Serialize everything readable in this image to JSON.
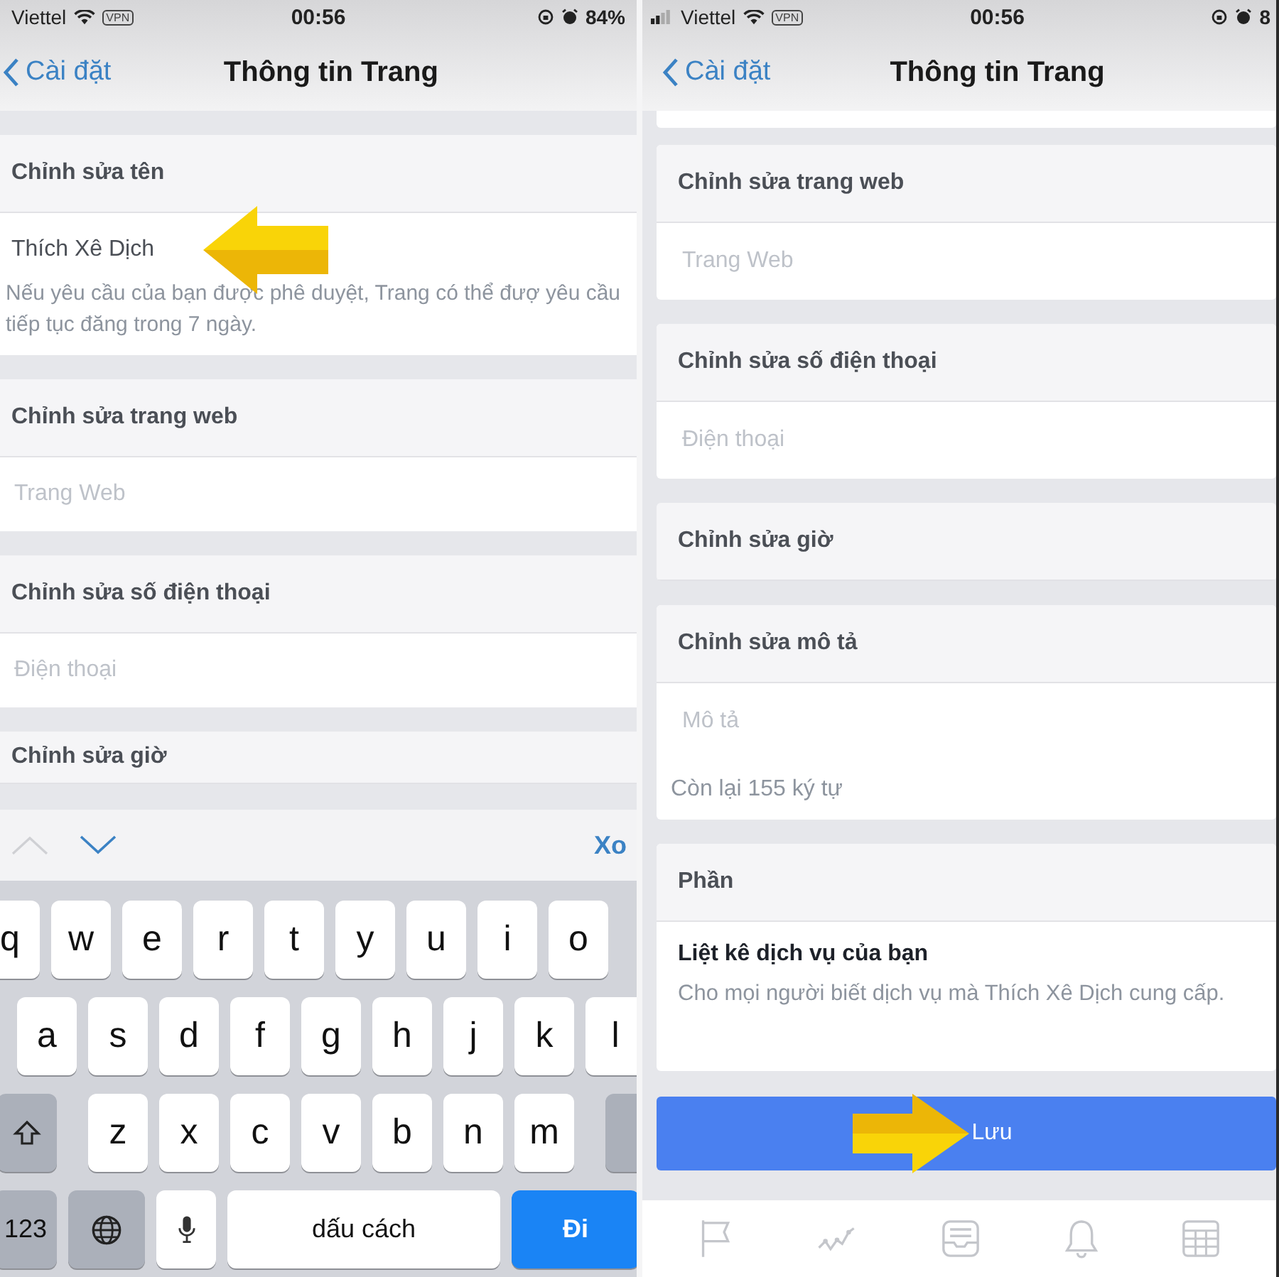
{
  "left_screen": {
    "status_bar": {
      "carrier": "Viettel",
      "vpn": "VPN",
      "time": "00:56",
      "battery": "84%"
    },
    "nav": {
      "back": "Cài đặt",
      "title": "Thông tin Trang"
    },
    "sections": [
      {
        "kind": "field",
        "header": "Chỉnh sửa tên",
        "value": "Thích Xê Dịch",
        "note": "Nếu yêu cầu của bạn được phê duyệt, Trang có thể đượ yêu cầu tiếp tục đăng trong 7 ngày.",
        "arrow": true
      },
      {
        "kind": "field",
        "header": "Chỉnh sửa trang web",
        "placeholder": "Trang Web",
        "arrow": false
      },
      {
        "kind": "field",
        "header": "Chỉnh sửa số điện thoại",
        "placeholder": "Điện thoại",
        "arrow": false
      },
      {
        "kind": "header",
        "header": "Chỉnh sửa giờ"
      }
    ],
    "keyboard": {
      "done": "Xo",
      "rows": [
        [
          "q",
          "w",
          "e",
          "r",
          "t",
          "y",
          "u",
          "i",
          "o"
        ],
        [
          "a",
          "s",
          "d",
          "f",
          "g",
          "h",
          "j",
          "k",
          "l"
        ],
        [
          "z",
          "x",
          "c",
          "v",
          "b",
          "n",
          "m"
        ]
      ],
      "numbers": "123",
      "space": "dấu cách",
      "go": "Đi"
    }
  },
  "right_screen": {
    "status_bar": {
      "carrier": "Viettel",
      "vpn": "VPN",
      "time": "00:56",
      "battery": "8"
    },
    "nav": {
      "back": "Cài đặt",
      "title": "Thông tin Trang"
    },
    "sections": [
      {
        "kind": "field",
        "header": "Chỉnh sửa trang web",
        "placeholder": "Trang Web"
      },
      {
        "kind": "field",
        "header": "Chỉnh sửa số điện thoại",
        "placeholder": "Điện thoại"
      },
      {
        "kind": "header",
        "header": "Chỉnh sửa giờ"
      },
      {
        "kind": "field",
        "header": "Chỉnh sửa mô tả",
        "placeholder": "Mô tả",
        "counter": "Còn lại 155 ký tự"
      },
      {
        "kind": "info",
        "header": "Phần",
        "title": "Liệt kê dịch vụ của bạn",
        "text": "Cho mọi người biết dịch vụ mà Thích Xê Dịch cung cấp."
      }
    ],
    "save_button": {
      "label": "Lưu",
      "arrow": true
    }
  }
}
